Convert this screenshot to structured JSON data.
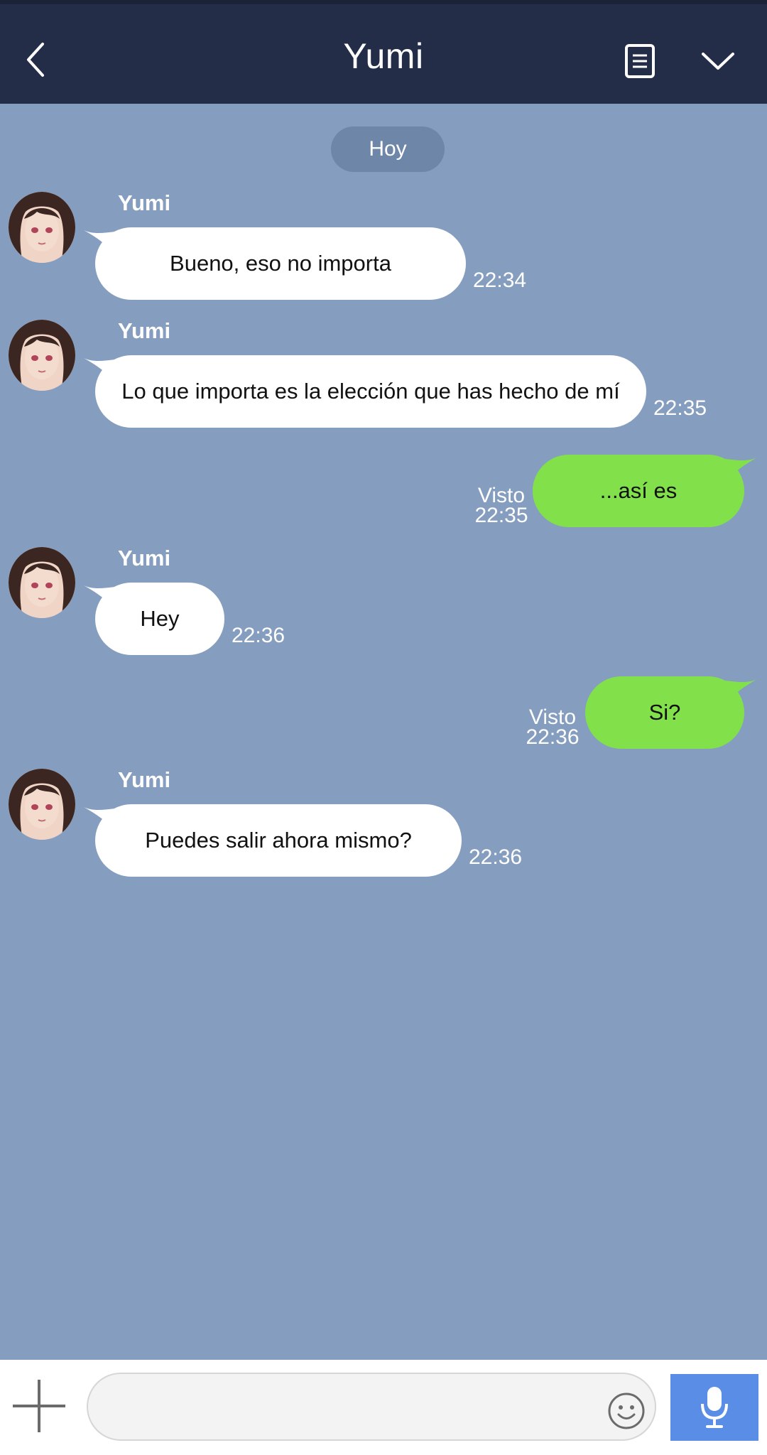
{
  "header": {
    "title": "Yumi"
  },
  "date_separator": "Hoy",
  "messages": [
    {
      "direction": "in",
      "sender": "Yumi",
      "text": "Bueno, eso no importa",
      "time": "22:34"
    },
    {
      "direction": "in",
      "sender": "Yumi",
      "text": "Lo que importa es la elección que has hecho de mí",
      "time": "22:35"
    },
    {
      "direction": "out",
      "status": "Visto",
      "text": "...así es",
      "time": "22:35"
    },
    {
      "direction": "in",
      "sender": "Yumi",
      "text": "Hey",
      "time": "22:36"
    },
    {
      "direction": "out",
      "status": "Visto",
      "text": "Si?",
      "time": "22:36"
    },
    {
      "direction": "in",
      "sender": "Yumi",
      "text": "Puedes salir ahora mismo?",
      "time": "22:36"
    }
  ],
  "composer": {
    "value": "",
    "placeholder": ""
  },
  "colors": {
    "header_bg": "#232d48",
    "chat_bg": "#859ebf",
    "incoming_bubble": "#ffffff",
    "outgoing_bubble": "#82e14a",
    "mic_button": "#5a8ee6"
  },
  "icons": {
    "back": "back-icon",
    "notes": "notes-icon",
    "menu": "chevron-down-icon",
    "attach": "plus-icon",
    "emoji": "emoji-icon",
    "voice": "microphone-icon"
  }
}
